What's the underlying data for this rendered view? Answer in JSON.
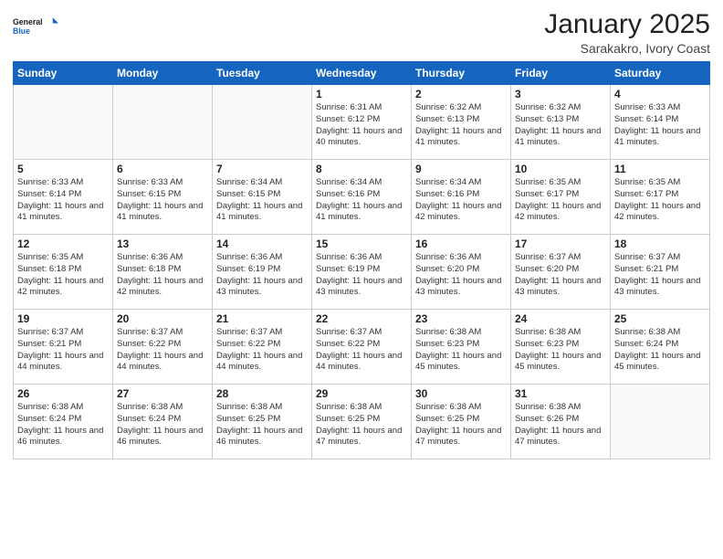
{
  "header": {
    "logo_line1": "General",
    "logo_line2": "Blue",
    "main_title": "January 2025",
    "sub_title": "Sarakakro, Ivory Coast"
  },
  "days_of_week": [
    "Sunday",
    "Monday",
    "Tuesday",
    "Wednesday",
    "Thursday",
    "Friday",
    "Saturday"
  ],
  "weeks": [
    [
      {
        "day": "",
        "sunrise": "",
        "sunset": "",
        "daylight": ""
      },
      {
        "day": "",
        "sunrise": "",
        "sunset": "",
        "daylight": ""
      },
      {
        "day": "",
        "sunrise": "",
        "sunset": "",
        "daylight": ""
      },
      {
        "day": "1",
        "sunrise": "Sunrise: 6:31 AM",
        "sunset": "Sunset: 6:12 PM",
        "daylight": "Daylight: 11 hours and 40 minutes."
      },
      {
        "day": "2",
        "sunrise": "Sunrise: 6:32 AM",
        "sunset": "Sunset: 6:13 PM",
        "daylight": "Daylight: 11 hours and 41 minutes."
      },
      {
        "day": "3",
        "sunrise": "Sunrise: 6:32 AM",
        "sunset": "Sunset: 6:13 PM",
        "daylight": "Daylight: 11 hours and 41 minutes."
      },
      {
        "day": "4",
        "sunrise": "Sunrise: 6:33 AM",
        "sunset": "Sunset: 6:14 PM",
        "daylight": "Daylight: 11 hours and 41 minutes."
      }
    ],
    [
      {
        "day": "5",
        "sunrise": "Sunrise: 6:33 AM",
        "sunset": "Sunset: 6:14 PM",
        "daylight": "Daylight: 11 hours and 41 minutes."
      },
      {
        "day": "6",
        "sunrise": "Sunrise: 6:33 AM",
        "sunset": "Sunset: 6:15 PM",
        "daylight": "Daylight: 11 hours and 41 minutes."
      },
      {
        "day": "7",
        "sunrise": "Sunrise: 6:34 AM",
        "sunset": "Sunset: 6:15 PM",
        "daylight": "Daylight: 11 hours and 41 minutes."
      },
      {
        "day": "8",
        "sunrise": "Sunrise: 6:34 AM",
        "sunset": "Sunset: 6:16 PM",
        "daylight": "Daylight: 11 hours and 41 minutes."
      },
      {
        "day": "9",
        "sunrise": "Sunrise: 6:34 AM",
        "sunset": "Sunset: 6:16 PM",
        "daylight": "Daylight: 11 hours and 42 minutes."
      },
      {
        "day": "10",
        "sunrise": "Sunrise: 6:35 AM",
        "sunset": "Sunset: 6:17 PM",
        "daylight": "Daylight: 11 hours and 42 minutes."
      },
      {
        "day": "11",
        "sunrise": "Sunrise: 6:35 AM",
        "sunset": "Sunset: 6:17 PM",
        "daylight": "Daylight: 11 hours and 42 minutes."
      }
    ],
    [
      {
        "day": "12",
        "sunrise": "Sunrise: 6:35 AM",
        "sunset": "Sunset: 6:18 PM",
        "daylight": "Daylight: 11 hours and 42 minutes."
      },
      {
        "day": "13",
        "sunrise": "Sunrise: 6:36 AM",
        "sunset": "Sunset: 6:18 PM",
        "daylight": "Daylight: 11 hours and 42 minutes."
      },
      {
        "day": "14",
        "sunrise": "Sunrise: 6:36 AM",
        "sunset": "Sunset: 6:19 PM",
        "daylight": "Daylight: 11 hours and 43 minutes."
      },
      {
        "day": "15",
        "sunrise": "Sunrise: 6:36 AM",
        "sunset": "Sunset: 6:19 PM",
        "daylight": "Daylight: 11 hours and 43 minutes."
      },
      {
        "day": "16",
        "sunrise": "Sunrise: 6:36 AM",
        "sunset": "Sunset: 6:20 PM",
        "daylight": "Daylight: 11 hours and 43 minutes."
      },
      {
        "day": "17",
        "sunrise": "Sunrise: 6:37 AM",
        "sunset": "Sunset: 6:20 PM",
        "daylight": "Daylight: 11 hours and 43 minutes."
      },
      {
        "day": "18",
        "sunrise": "Sunrise: 6:37 AM",
        "sunset": "Sunset: 6:21 PM",
        "daylight": "Daylight: 11 hours and 43 minutes."
      }
    ],
    [
      {
        "day": "19",
        "sunrise": "Sunrise: 6:37 AM",
        "sunset": "Sunset: 6:21 PM",
        "daylight": "Daylight: 11 hours and 44 minutes."
      },
      {
        "day": "20",
        "sunrise": "Sunrise: 6:37 AM",
        "sunset": "Sunset: 6:22 PM",
        "daylight": "Daylight: 11 hours and 44 minutes."
      },
      {
        "day": "21",
        "sunrise": "Sunrise: 6:37 AM",
        "sunset": "Sunset: 6:22 PM",
        "daylight": "Daylight: 11 hours and 44 minutes."
      },
      {
        "day": "22",
        "sunrise": "Sunrise: 6:37 AM",
        "sunset": "Sunset: 6:22 PM",
        "daylight": "Daylight: 11 hours and 44 minutes."
      },
      {
        "day": "23",
        "sunrise": "Sunrise: 6:38 AM",
        "sunset": "Sunset: 6:23 PM",
        "daylight": "Daylight: 11 hours and 45 minutes."
      },
      {
        "day": "24",
        "sunrise": "Sunrise: 6:38 AM",
        "sunset": "Sunset: 6:23 PM",
        "daylight": "Daylight: 11 hours and 45 minutes."
      },
      {
        "day": "25",
        "sunrise": "Sunrise: 6:38 AM",
        "sunset": "Sunset: 6:24 PM",
        "daylight": "Daylight: 11 hours and 45 minutes."
      }
    ],
    [
      {
        "day": "26",
        "sunrise": "Sunrise: 6:38 AM",
        "sunset": "Sunset: 6:24 PM",
        "daylight": "Daylight: 11 hours and 46 minutes."
      },
      {
        "day": "27",
        "sunrise": "Sunrise: 6:38 AM",
        "sunset": "Sunset: 6:24 PM",
        "daylight": "Daylight: 11 hours and 46 minutes."
      },
      {
        "day": "28",
        "sunrise": "Sunrise: 6:38 AM",
        "sunset": "Sunset: 6:25 PM",
        "daylight": "Daylight: 11 hours and 46 minutes."
      },
      {
        "day": "29",
        "sunrise": "Sunrise: 6:38 AM",
        "sunset": "Sunset: 6:25 PM",
        "daylight": "Daylight: 11 hours and 47 minutes."
      },
      {
        "day": "30",
        "sunrise": "Sunrise: 6:38 AM",
        "sunset": "Sunset: 6:25 PM",
        "daylight": "Daylight: 11 hours and 47 minutes."
      },
      {
        "day": "31",
        "sunrise": "Sunrise: 6:38 AM",
        "sunset": "Sunset: 6:26 PM",
        "daylight": "Daylight: 11 hours and 47 minutes."
      },
      {
        "day": "",
        "sunrise": "",
        "sunset": "",
        "daylight": ""
      }
    ]
  ]
}
